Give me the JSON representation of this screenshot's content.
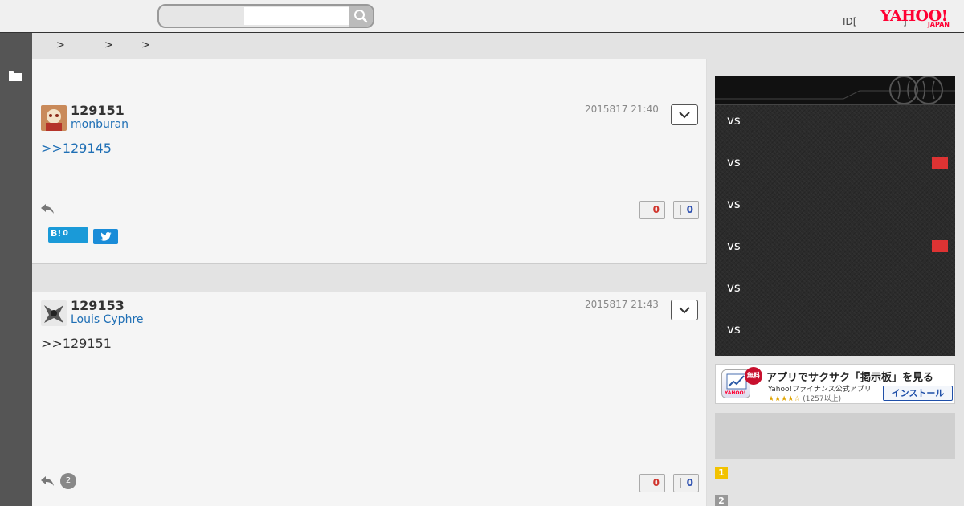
{
  "header": {
    "search_placeholder": "",
    "id_link": "ID[",
    "id_bracket_close": "]",
    "logo_main": "YAHOO!",
    "logo_sub": "JAPAN"
  },
  "breadcrumb": {
    "separators": [
      ">",
      ">",
      ">"
    ]
  },
  "posts": [
    {
      "number": "129151",
      "username": "monburan",
      "date": "2015817 21:40",
      "body": ">>129145",
      "likes": "0",
      "dislikes": "0",
      "hatena_label": "B!",
      "hatena_count": "0"
    },
    {
      "number": "129153",
      "username": "Louis Cyphre",
      "date": "2015817 21:43",
      "body": ">>129151",
      "reply_count": "2",
      "likes": "0",
      "dislikes": "0"
    }
  ],
  "games": {
    "rows": [
      {
        "label": "vs",
        "flag": false
      },
      {
        "label": "vs",
        "flag": true
      },
      {
        "label": "vs",
        "flag": false
      },
      {
        "label": "vs",
        "flag": true
      },
      {
        "label": "vs",
        "flag": false
      },
      {
        "label": "vs",
        "flag": false
      }
    ],
    "flag_color": "#dd3333"
  },
  "app_banner": {
    "badge": "無料",
    "title": "アプリでサクサク「掲示板」を見る",
    "subtitle": "Yahoo!ファイナンス公式アプリ",
    "stars": "★★★★☆",
    "rating_count": "(1257以上)",
    "install_label": "インストール",
    "icon_text": "YAHOO!"
  },
  "ranking": {
    "items": [
      {
        "rank": "1",
        "color": "#f2c200"
      },
      {
        "rank": "2",
        "color": "#999999"
      }
    ]
  },
  "colors": {
    "link": "#1f6fb5",
    "like": "#d0342c",
    "dislike": "#2c4fb0",
    "yahoo_red": "#ff0033",
    "rail": "#555555"
  }
}
